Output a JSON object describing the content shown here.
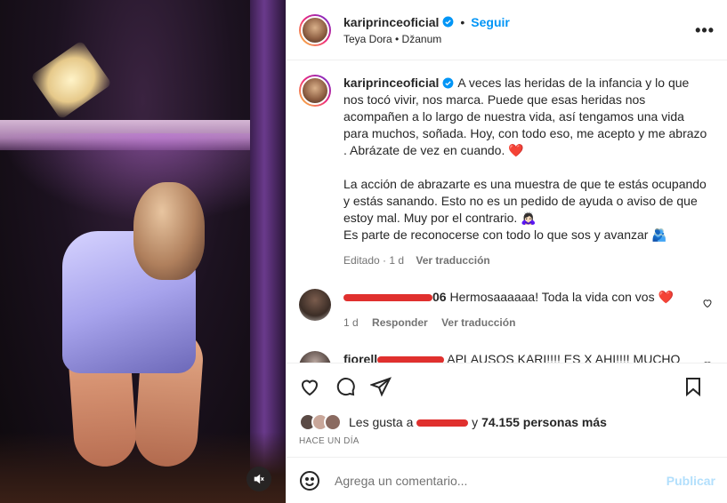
{
  "header": {
    "username": "kariprinceoficial",
    "follow_label": "Seguir",
    "audio": "Teya Dora • Džanum",
    "more_label": "•••"
  },
  "caption": {
    "username": "kariprinceoficial",
    "text1": "A veces las heridas de la infancia y lo que nos tocó vivir, nos marca. Puede que esas heridas nos acompañen a lo largo de nuestra vida, así tengamos una vida para muchos, soñada. Hoy, con todo eso, me acepto y me abrazo . Abrázate de vez en cuando. ",
    "heart": "❤️",
    "text2": "La acción de abrazarte es una muestra de que te estás ocupando y estás sanando. Esto no es un pedido de ayuda o aviso de que estoy mal. Muy por el contrario. 🙇🏻‍♀️",
    "text3": "Es parte de reconocerse con todo lo que sos y avanzar 🫂",
    "edited": "Editado · 1 d",
    "translate": "Ver traducción"
  },
  "comments": [
    {
      "username_suffix": "06",
      "text": "Hermosaaaaaa! Toda la vida con vos ",
      "heart": "❤️",
      "time": "1 d",
      "reply": "Responder",
      "translate": "Ver traducción"
    },
    {
      "username_prefix": "fiorell",
      "text": "APLAUSOS KARI!!!! ES X AHI!!!! MUCHO AMOR PARA ESE PROCESO!!!! CUANDO ACEPTAS Y SENTIS SANAS!!!"
    }
  ],
  "likes": {
    "prefix": "Les gusta a",
    "connector": "y",
    "count": "74.155 personas más"
  },
  "date": "HACE UN DÍA",
  "add_comment": {
    "placeholder": "Agrega un comentario...",
    "post_label": "Publicar"
  },
  "colors": {
    "accent": "#0095f6",
    "redaction": "#e0302e",
    "heart": "#ed1b24",
    "post_disabled": "#b2dffc"
  }
}
